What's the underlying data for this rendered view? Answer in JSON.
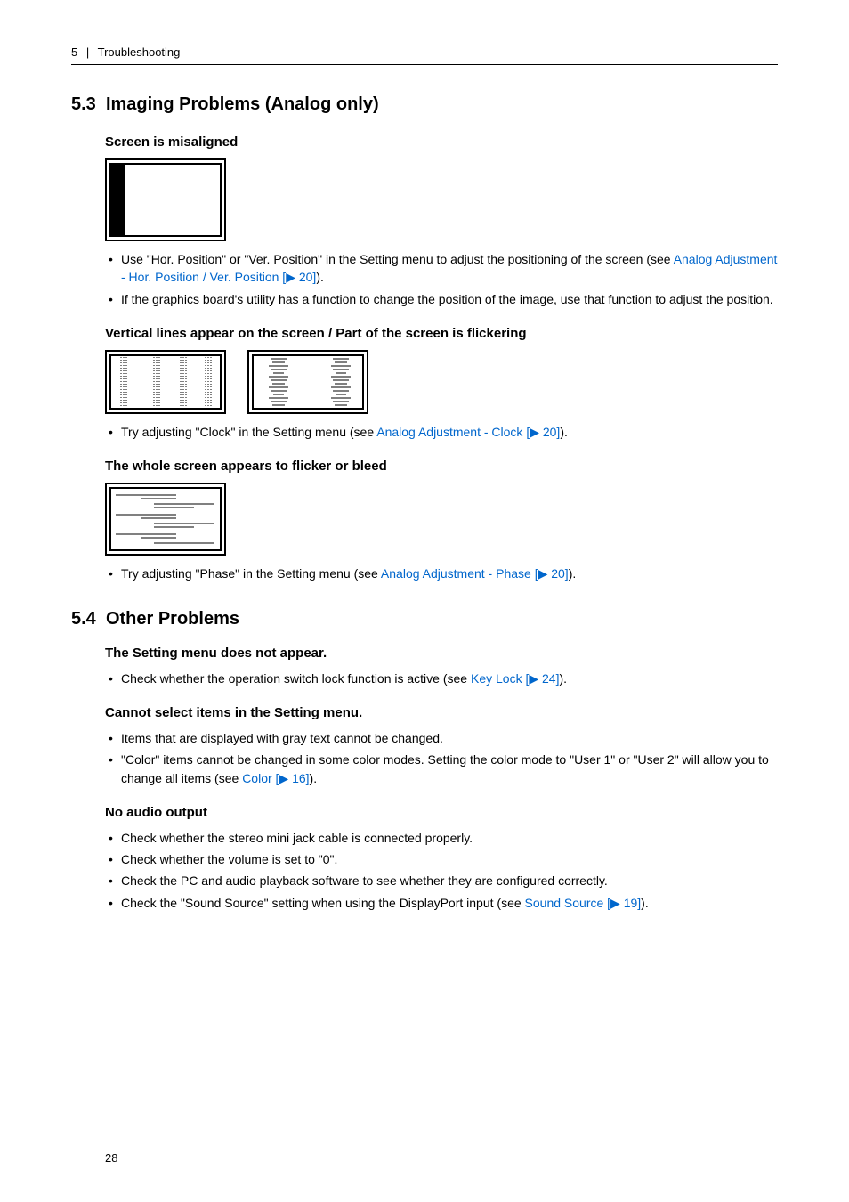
{
  "header": {
    "chapter": "5",
    "sep": "|",
    "title": "Troubleshooting"
  },
  "s53": {
    "num": "5.3",
    "title": "Imaging Problems (Analog only)",
    "sub1": {
      "title": "Screen is misaligned",
      "bullets": [
        {
          "pre": "Use \"Hor. Position\" or \"Ver. Position\" in the Setting menu to adjust the positioning of the screen (see ",
          "link": "Analog Adjustment - Hor. Position / Ver. Position [▶ 20]",
          "post": ")."
        },
        {
          "pre": "If the graphics board's utility has a function to change the position of the image, use that function to adjust the position.",
          "link": "",
          "post": ""
        }
      ]
    },
    "sub2": {
      "title": "Vertical lines appear on the screen / Part of the screen is flickering",
      "bullets": [
        {
          "pre": "Try adjusting \"Clock\" in the Setting menu (see ",
          "link": "Analog Adjustment - Clock [▶ 20]",
          "post": ")."
        }
      ]
    },
    "sub3": {
      "title": "The whole screen appears to flicker or bleed",
      "bullets": [
        {
          "pre": "Try adjusting \"Phase\" in the Setting menu (see ",
          "link": "Analog Adjustment - Phase [▶ 20]",
          "post": ")."
        }
      ]
    }
  },
  "s54": {
    "num": "5.4",
    "title": "Other Problems",
    "sub1": {
      "title": "The Setting menu does not appear.",
      "bullets": [
        {
          "pre": "Check whether the operation switch lock function is active (see ",
          "link": "Key Lock [▶ 24]",
          "post": ")."
        }
      ]
    },
    "sub2": {
      "title": "Cannot select items in the Setting menu.",
      "bullets": [
        {
          "pre": "Items that are displayed with gray text cannot be changed.",
          "link": "",
          "post": ""
        },
        {
          "pre": "\"Color\" items cannot be changed in some color modes. Setting the color mode to \"User 1\" or \"User 2\" will allow you to change all items (see ",
          "link": "Color [▶ 16]",
          "post": ")."
        }
      ]
    },
    "sub3": {
      "title": "No audio output",
      "bullets": [
        {
          "pre": "Check whether the stereo mini jack cable is connected properly.",
          "link": "",
          "post": ""
        },
        {
          "pre": "Check whether the volume is set to \"0\".",
          "link": "",
          "post": ""
        },
        {
          "pre": "Check the PC and audio playback software to see whether they are configured correctly.",
          "link": "",
          "post": ""
        },
        {
          "pre": "Check the \"Sound Source\" setting when using the DisplayPort input (see ",
          "link": "Sound Source [▶ 19]",
          "post": ")."
        }
      ]
    }
  },
  "pageNumber": "28"
}
